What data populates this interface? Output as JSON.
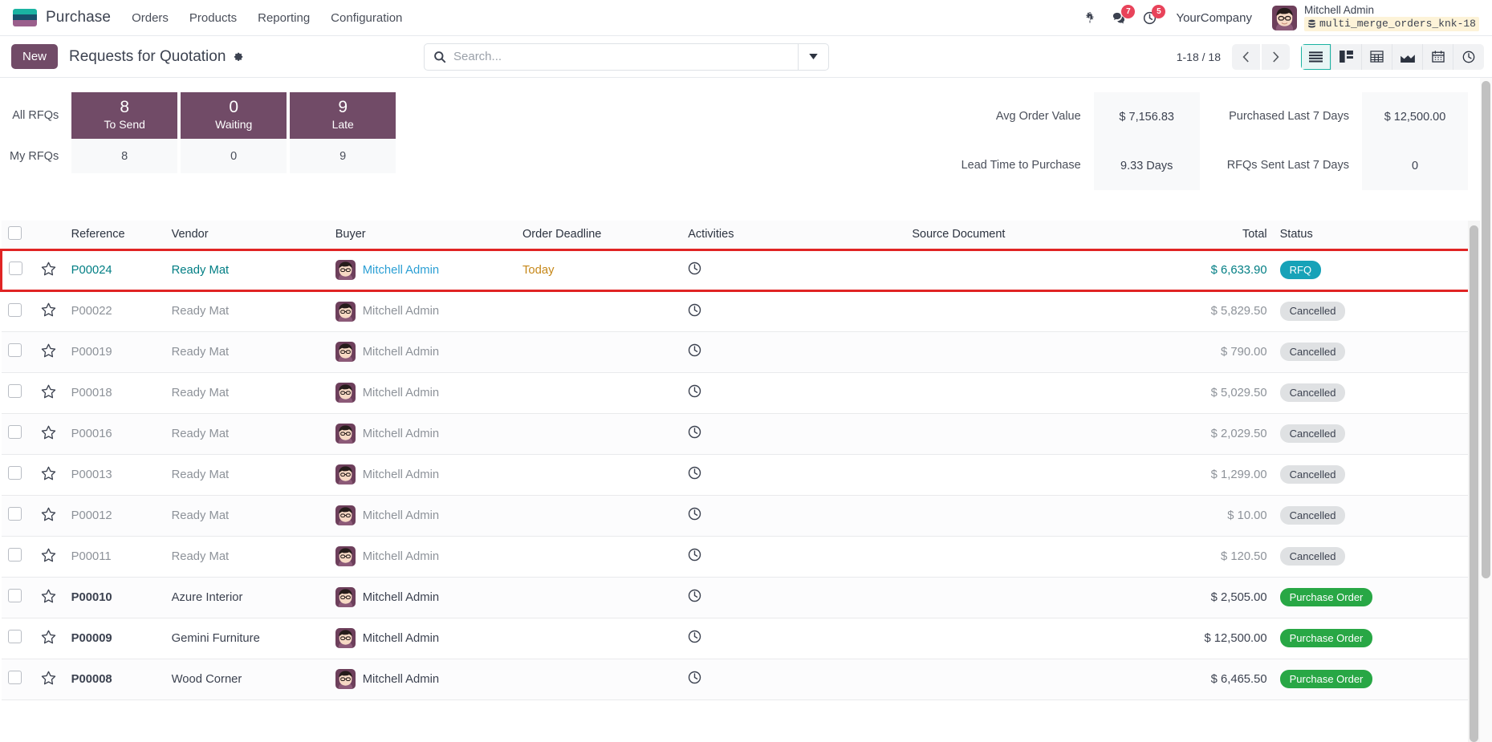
{
  "navbar": {
    "app_name": "Purchase",
    "menu": [
      {
        "label": "Orders"
      },
      {
        "label": "Products"
      },
      {
        "label": "Reporting"
      },
      {
        "label": "Configuration"
      }
    ],
    "debug_icon": "bug-icon",
    "messages_icon": "messages-icon",
    "messages_count": "7",
    "activities_icon": "activities-clock-icon",
    "activities_count": "5",
    "company": "YourCompany",
    "user_name": "Mitchell Admin",
    "database": "multi_merge_orders_knk-18",
    "database_icon": "database-icon"
  },
  "control_panel": {
    "new_label": "New",
    "breadcrumb": "Requests for Quotation",
    "settings_icon": "gear-icon",
    "search": {
      "placeholder": "Search...",
      "value": "",
      "icon": "search-icon",
      "toggle_icon": "chevron-down-icon"
    },
    "pager": "1-18 / 18",
    "prev_icon": "chevron-left-icon",
    "next_icon": "chevron-right-icon",
    "views": [
      {
        "name": "list-view",
        "icon": "list-icon",
        "active": true
      },
      {
        "name": "kanban-view",
        "icon": "kanban-icon",
        "active": false
      },
      {
        "name": "pivot-view",
        "icon": "pivot-icon",
        "active": false
      },
      {
        "name": "graph-view",
        "icon": "graph-icon",
        "active": false
      },
      {
        "name": "calendar-view",
        "icon": "calendar-icon",
        "active": false
      },
      {
        "name": "activity-view",
        "icon": "clock-icon",
        "active": false
      }
    ]
  },
  "dashboard": {
    "row_labels": {
      "all": "All RFQs",
      "my": "My RFQs"
    },
    "tiles": [
      {
        "label": "To Send",
        "all": "8",
        "my": "8"
      },
      {
        "label": "Waiting",
        "all": "0",
        "my": "0"
      },
      {
        "label": "Late",
        "all": "9",
        "my": "9"
      }
    ],
    "stats": [
      {
        "label": "Avg Order Value",
        "value": "$ 7,156.83"
      },
      {
        "label": "Purchased Last 7 Days",
        "value": "$ 12,500.00"
      },
      {
        "label": "Lead Time to Purchase",
        "value": "9.33 Days"
      },
      {
        "label": "RFQs Sent Last 7 Days",
        "value": "0"
      }
    ],
    "tile_color": "#714B67"
  },
  "table": {
    "columns": [
      "Reference",
      "Vendor",
      "Buyer",
      "Order Deadline",
      "Activities",
      "Source Document",
      "Total",
      "Status"
    ],
    "optional_columns_icon": "adjust-columns-icon",
    "activity_icon": "clock-icon",
    "star_icon": "star-outline-icon",
    "checkbox_icon": "checkbox-icon",
    "rows": [
      {
        "reference": "P00024",
        "vendor": "Ready Mat",
        "buyer": "Mitchell Admin",
        "deadline": "Today",
        "source": "",
        "total": "$ 6,633.90",
        "status": "RFQ",
        "status_type": "rfq",
        "highlighted": true
      },
      {
        "reference": "P00022",
        "vendor": "Ready Mat",
        "buyer": "Mitchell Admin",
        "deadline": "",
        "source": "",
        "total": "$ 5,829.50",
        "status": "Cancelled",
        "status_type": "cancelled",
        "highlighted": false
      },
      {
        "reference": "P00019",
        "vendor": "Ready Mat",
        "buyer": "Mitchell Admin",
        "deadline": "",
        "source": "",
        "total": "$ 790.00",
        "status": "Cancelled",
        "status_type": "cancelled",
        "highlighted": false
      },
      {
        "reference": "P00018",
        "vendor": "Ready Mat",
        "buyer": "Mitchell Admin",
        "deadline": "",
        "source": "",
        "total": "$ 5,029.50",
        "status": "Cancelled",
        "status_type": "cancelled",
        "highlighted": false
      },
      {
        "reference": "P00016",
        "vendor": "Ready Mat",
        "buyer": "Mitchell Admin",
        "deadline": "",
        "source": "",
        "total": "$ 2,029.50",
        "status": "Cancelled",
        "status_type": "cancelled",
        "highlighted": false
      },
      {
        "reference": "P00013",
        "vendor": "Ready Mat",
        "buyer": "Mitchell Admin",
        "deadline": "",
        "source": "",
        "total": "$ 1,299.00",
        "status": "Cancelled",
        "status_type": "cancelled",
        "highlighted": false
      },
      {
        "reference": "P00012",
        "vendor": "Ready Mat",
        "buyer": "Mitchell Admin",
        "deadline": "",
        "source": "",
        "total": "$ 10.00",
        "status": "Cancelled",
        "status_type": "cancelled",
        "highlighted": false
      },
      {
        "reference": "P00011",
        "vendor": "Ready Mat",
        "buyer": "Mitchell Admin",
        "deadline": "",
        "source": "",
        "total": "$ 120.50",
        "status": "Cancelled",
        "status_type": "cancelled",
        "highlighted": false
      },
      {
        "reference": "P00010",
        "vendor": "Azure Interior",
        "buyer": "Mitchell Admin",
        "deadline": "",
        "source": "",
        "total": "$ 2,505.00",
        "status": "Purchase Order",
        "status_type": "po",
        "highlighted": false
      },
      {
        "reference": "P00009",
        "vendor": "Gemini Furniture",
        "buyer": "Mitchell Admin",
        "deadline": "",
        "source": "",
        "total": "$ 12,500.00",
        "status": "Purchase Order",
        "status_type": "po",
        "highlighted": false
      },
      {
        "reference": "P00008",
        "vendor": "Wood Corner",
        "buyer": "Mitchell Admin",
        "deadline": "",
        "source": "",
        "total": "$ 6,465.50",
        "status": "Purchase Order",
        "status_type": "po",
        "highlighted": false
      }
    ]
  }
}
